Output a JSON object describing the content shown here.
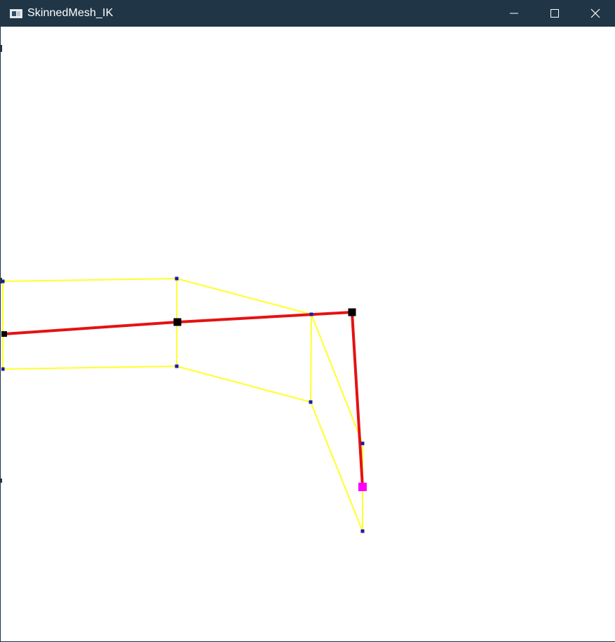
{
  "window": {
    "title": "SkinnedMesh_IK",
    "app_icon": "app-window-icon",
    "controls": [
      {
        "name": "minimize-button",
        "icon": "minimize-icon"
      },
      {
        "name": "maximize-button",
        "icon": "maximize-icon"
      },
      {
        "name": "close-button",
        "icon": "close-icon"
      }
    ]
  },
  "scene": {
    "background": "#ffffff",
    "colors": {
      "bone": "#e51212",
      "joint": "#000000",
      "mesh_edge": "#ffff2a",
      "mesh_vertex": "#1a1aa8",
      "ik_target": "#ff00ff"
    }
  }
}
